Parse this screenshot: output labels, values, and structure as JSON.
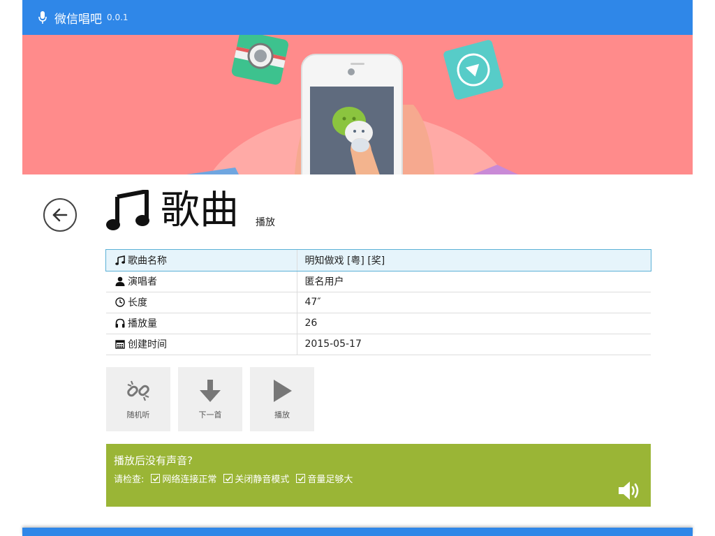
{
  "header": {
    "title": "微信唱吧",
    "version": "0.0.1"
  },
  "page": {
    "title": "歌曲",
    "subtitle": "播放"
  },
  "info": [
    {
      "icon": "music-note-icon",
      "label": "歌曲名称",
      "value": "明知做戏 [粤] [奖]"
    },
    {
      "icon": "user-icon",
      "label": "演唱者",
      "value": "匿名用户"
    },
    {
      "icon": "clock-icon",
      "label": "长度",
      "value": "47″"
    },
    {
      "icon": "headphones-icon",
      "label": "播放量",
      "value": "26"
    },
    {
      "icon": "calendar-icon",
      "label": "创建时间",
      "value": "2015-05-17"
    }
  ],
  "actions": {
    "random": "随机听",
    "next": "下一首",
    "play": "播放"
  },
  "tip": {
    "title": "播放后没有声音?",
    "check_label": "请检查:",
    "items": [
      "网络连接正常",
      "关闭静音模式",
      "音量足够大"
    ]
  },
  "colors": {
    "header": "#2f87e8",
    "banner": "#ff8b8b",
    "tip": "#9ab536",
    "highlight_row": "#e6f4fb"
  }
}
